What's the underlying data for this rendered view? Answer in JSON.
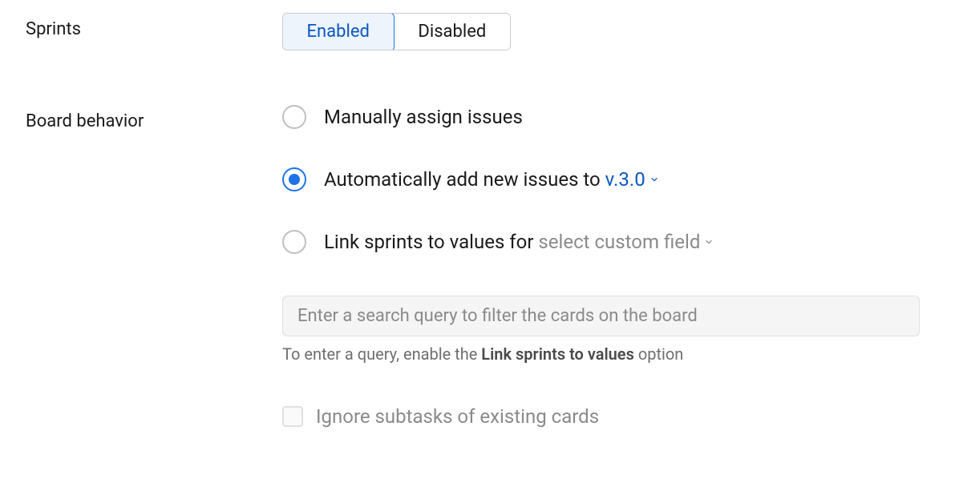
{
  "sprints": {
    "label": "Sprints",
    "enabled": "Enabled",
    "disabled": "Disabled"
  },
  "board": {
    "label": "Board behavior",
    "options": {
      "manual": "Manually assign issues",
      "auto_prefix": "Automatically add new issues to ",
      "auto_value": "v.3.0",
      "link_prefix": "Link sprints to values for ",
      "link_value": "select custom field"
    },
    "search_placeholder": "Enter a search query to filter the cards on the board",
    "hint_prefix": "To enter a query, enable the ",
    "hint_bold": "Link sprints to values",
    "hint_suffix": " option",
    "ignore_subtasks": "Ignore subtasks of existing cards"
  }
}
